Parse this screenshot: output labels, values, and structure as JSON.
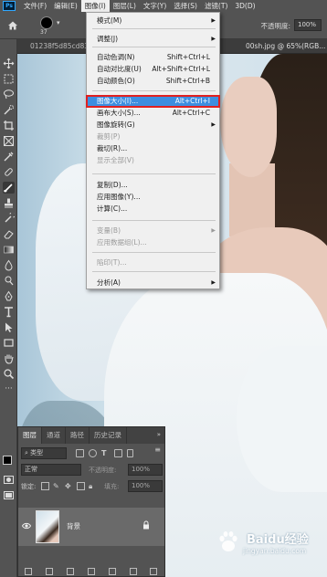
{
  "menubar": {
    "logo": "Ps",
    "items": [
      "文件(F)",
      "编辑(E)",
      "图像(I)",
      "图层(L)",
      "文字(Y)",
      "选择(S)",
      "滤镜(T)",
      "3D(D)"
    ]
  },
  "options": {
    "brush_size": "37",
    "opacity_label": "不透明度:",
    "opacity_value": "100%"
  },
  "document": {
    "tab_left": "01238f5d85cd83",
    "tab_right": "00sh.jpg @ 65%(RGB..."
  },
  "image_menu": {
    "items": [
      {
        "label": "模式(M)",
        "shortcut": "",
        "submenu": true,
        "disabled": false
      },
      {
        "label": "调整(J)",
        "shortcut": "",
        "submenu": true,
        "disabled": false
      },
      {
        "label": "自动色调(N)",
        "shortcut": "Shift+Ctrl+L",
        "submenu": false,
        "disabled": false
      },
      {
        "label": "自动对比度(U)",
        "shortcut": "Alt+Shift+Ctrl+L",
        "submenu": false,
        "disabled": false
      },
      {
        "label": "自动颜色(O)",
        "shortcut": "Shift+Ctrl+B",
        "submenu": false,
        "disabled": false
      },
      {
        "label": "图像大小(I)...",
        "shortcut": "Alt+Ctrl+I",
        "submenu": false,
        "disabled": false,
        "highlighted": true
      },
      {
        "label": "画布大小(S)...",
        "shortcut": "Alt+Ctrl+C",
        "submenu": false,
        "disabled": false
      },
      {
        "label": "图像旋转(G)",
        "shortcut": "",
        "submenu": true,
        "disabled": false
      },
      {
        "label": "裁剪(P)",
        "shortcut": "",
        "submenu": false,
        "disabled": true
      },
      {
        "label": "裁切(R)...",
        "shortcut": "",
        "submenu": false,
        "disabled": false
      },
      {
        "label": "显示全部(V)",
        "shortcut": "",
        "submenu": false,
        "disabled": true
      },
      {
        "label": "复制(D)...",
        "shortcut": "",
        "submenu": false,
        "disabled": false
      },
      {
        "label": "应用图像(Y)...",
        "shortcut": "",
        "submenu": false,
        "disabled": false
      },
      {
        "label": "计算(C)...",
        "shortcut": "",
        "submenu": false,
        "disabled": false
      },
      {
        "label": "变量(B)",
        "shortcut": "",
        "submenu": true,
        "disabled": true
      },
      {
        "label": "应用数据组(L)...",
        "shortcut": "",
        "submenu": false,
        "disabled": true
      },
      {
        "label": "陷印(T)...",
        "shortcut": "",
        "submenu": false,
        "disabled": true
      },
      {
        "label": "分析(A)",
        "shortcut": "",
        "submenu": true,
        "disabled": false
      }
    ]
  },
  "layers_panel": {
    "tabs": [
      "图层",
      "通道",
      "路径",
      "历史记录"
    ],
    "kind_label": "类型",
    "blend_mode": "正常",
    "opacity_label": "不透明度:",
    "opacity_value": "100%",
    "lock_label": "锁定:",
    "fill_label": "填充:",
    "fill_value": "100%",
    "layer_name": "背景"
  },
  "watermark": {
    "text": "Baidu经验",
    "url": "jingyan.baidu.com"
  },
  "colors": {
    "accent": "#3d8ee0",
    "highlight_border": "#e02020",
    "ui_panel": "#535353"
  }
}
